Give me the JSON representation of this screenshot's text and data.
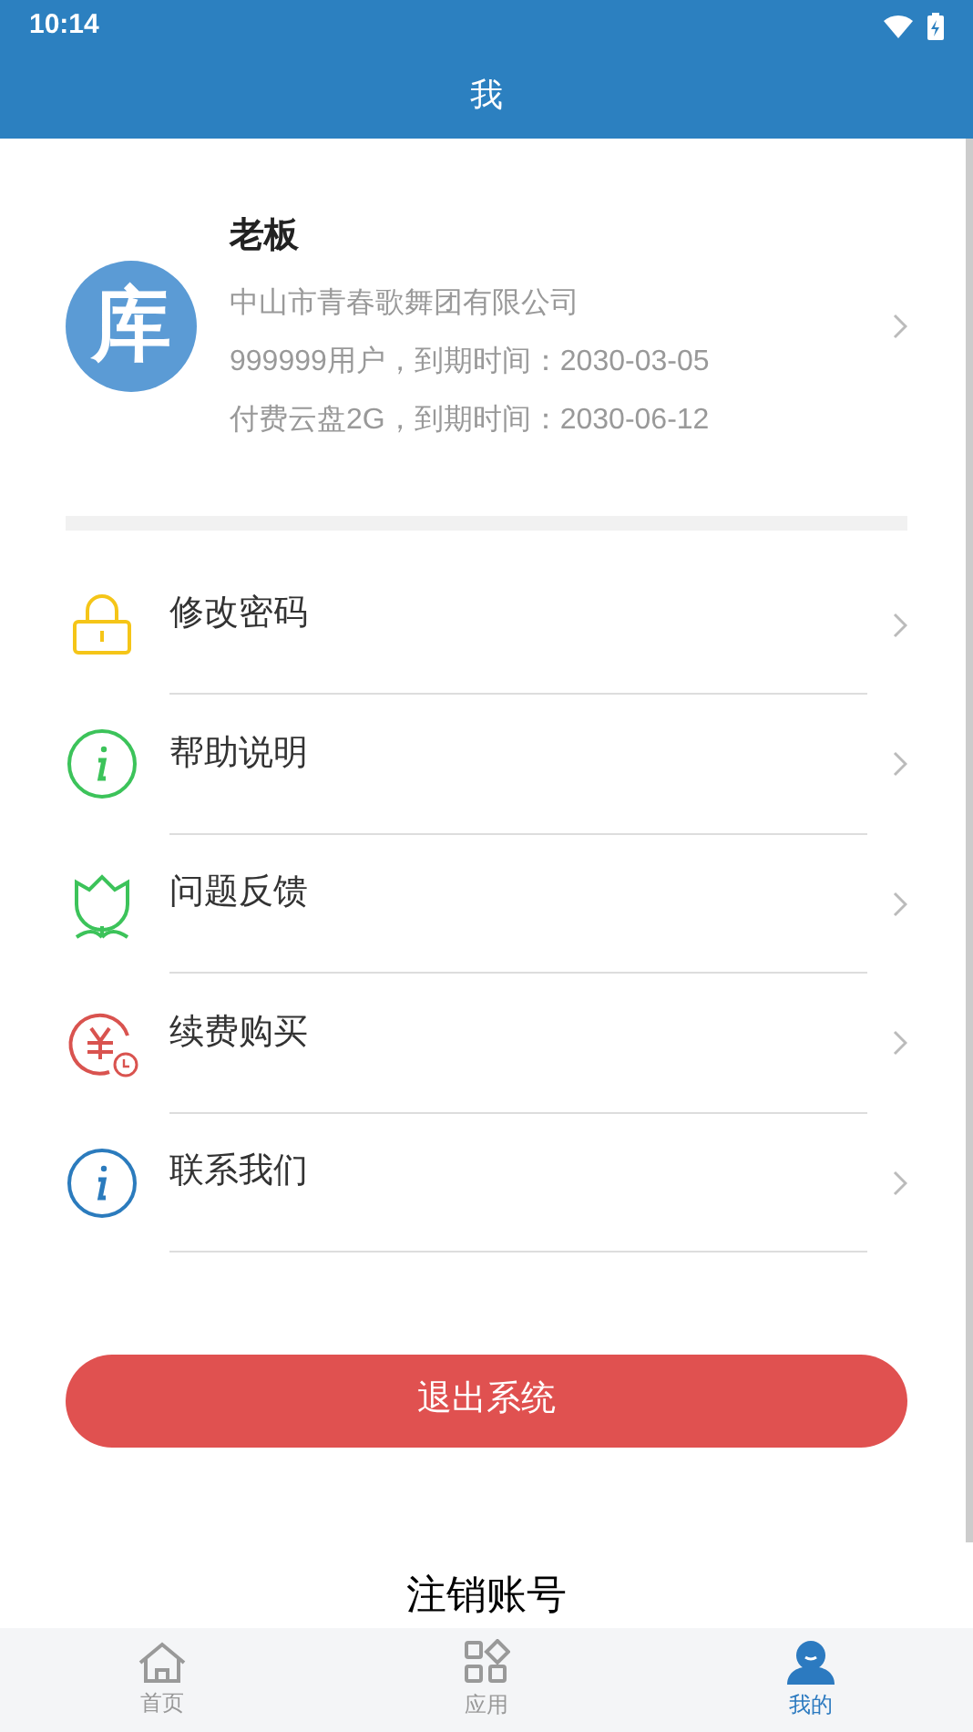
{
  "status_bar": {
    "time": "10:14"
  },
  "header": {
    "title": "我"
  },
  "profile": {
    "avatar_char": "库",
    "name": "老板",
    "company": "中山市青春歌舞团有限公司",
    "lines": [
      "999999用户，到期时间：2030-03-05",
      "付费云盘2G，到期时间：2030-06-12"
    ]
  },
  "menu": [
    {
      "label": "修改密码",
      "kind": "lock",
      "color": "#f5c518"
    },
    {
      "label": "帮助说明",
      "kind": "info",
      "color": "#3cc35a"
    },
    {
      "label": "问题反馈",
      "kind": "flower",
      "color": "#3cc35a"
    },
    {
      "label": "续费购买",
      "kind": "money",
      "color": "#d9534f"
    },
    {
      "label": "联系我们",
      "kind": "info",
      "color": "#2b7bbd"
    }
  ],
  "logout_button": "退出系统",
  "cancel_account": "注销账号",
  "tabs": [
    {
      "label": "首页",
      "kind": "home",
      "selected": false
    },
    {
      "label": "应用",
      "kind": "apps",
      "selected": false
    },
    {
      "label": "我的",
      "kind": "me",
      "selected": true
    }
  ]
}
